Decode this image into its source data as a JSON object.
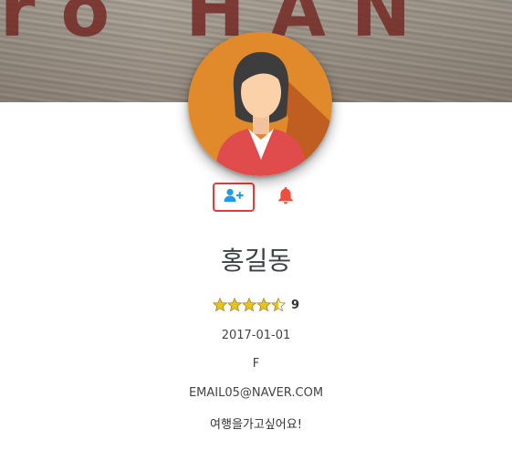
{
  "cover": {
    "text": "ro HAN"
  },
  "profile": {
    "name": "홍길동",
    "rating": 4.5,
    "rating_max": 5,
    "rating_count": "9",
    "birthdate": "2017-01-01",
    "gender": "F",
    "email": "EMAIL05@NAVER.COM",
    "bio": "여행을가고싶어요!"
  },
  "actions": {
    "follow_icon": "user-plus-icon",
    "notify_icon": "bell-icon"
  },
  "colors": {
    "accent_blue": "#1e9be8",
    "bell_red": "#f04e3e",
    "follow_border": "#e23d3d",
    "star_gold": "#e8c21f",
    "avatar_bg": "#e08a2c",
    "jacket": "#e04b4b"
  }
}
